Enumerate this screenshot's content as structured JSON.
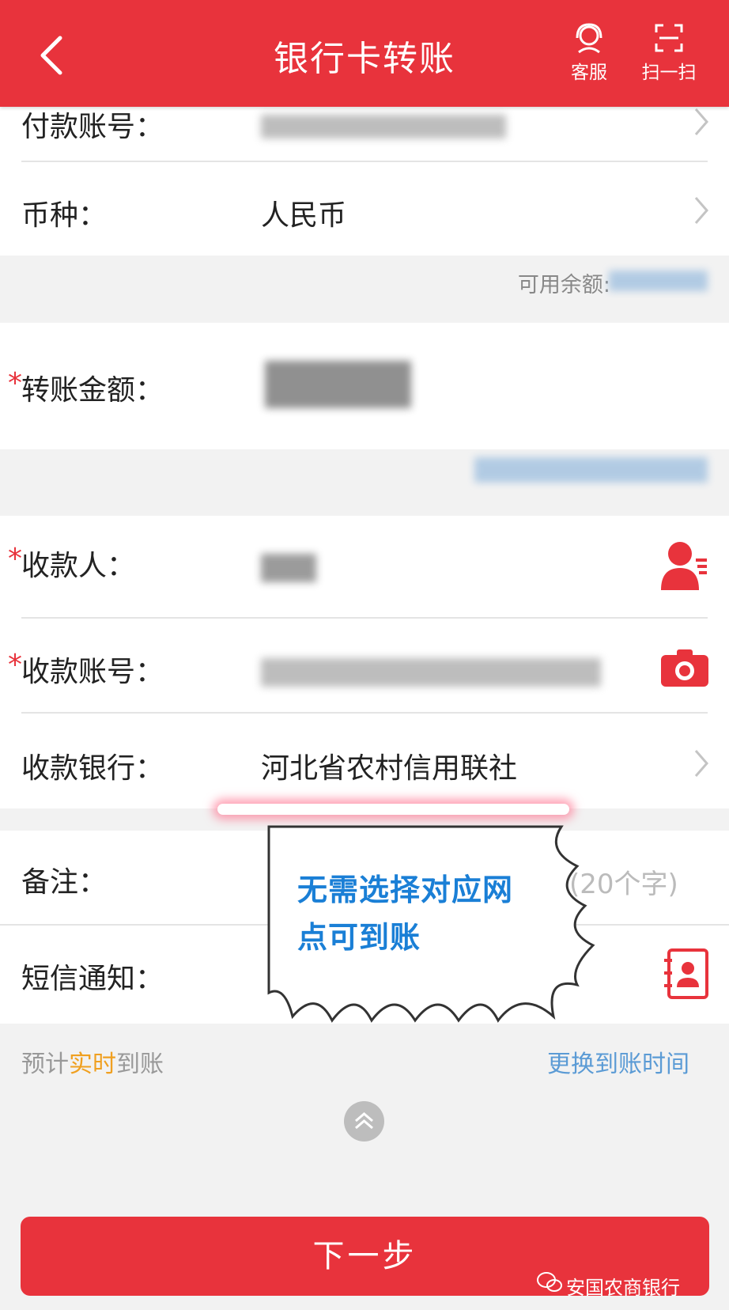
{
  "header": {
    "title": "银行卡转账",
    "service_label": "客服",
    "scan_label": "扫一扫"
  },
  "form": {
    "payer_account_label": "付款账号：",
    "currency_label": "币种：",
    "currency_value": "人民币",
    "available_balance_label": "可用余额:",
    "amount_label": "转账金额：",
    "payee_label": "收款人：",
    "payee_account_label": "收款账号：",
    "payee_bank_label": "收款银行：",
    "payee_bank_value": "河北省农村信用联社",
    "remark_label": "备注：",
    "remark_placeholder_tail": "(20个字)",
    "sms_label": "短信通知：",
    "required_mark": "*"
  },
  "arrival": {
    "prefix": "预计",
    "highlight": "实时",
    "suffix": "到账",
    "change_time_link": "更换到账时间"
  },
  "annotation": {
    "line1": "无需选择对应网",
    "line2": "点可到账"
  },
  "footer": {
    "next_button": "下一步",
    "watermark": "安国农商银行"
  },
  "colors": {
    "brand_red": "#e8333c",
    "link_blue": "#5b9bd5",
    "highlight_orange": "#f0a020",
    "annotation_blue": "#1a7fd6"
  }
}
